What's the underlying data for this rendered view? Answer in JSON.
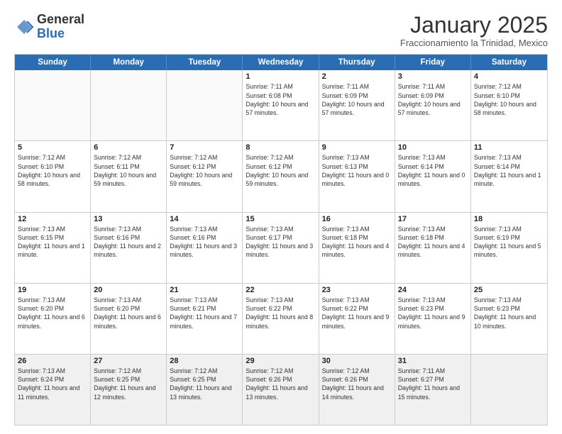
{
  "logo": {
    "general": "General",
    "blue": "Blue"
  },
  "header": {
    "month": "January 2025",
    "location": "Fraccionamiento la Trinidad, Mexico"
  },
  "weekdays": [
    "Sunday",
    "Monday",
    "Tuesday",
    "Wednesday",
    "Thursday",
    "Friday",
    "Saturday"
  ],
  "weeks": [
    [
      {
        "day": "",
        "info": "",
        "empty": true
      },
      {
        "day": "",
        "info": "",
        "empty": true
      },
      {
        "day": "",
        "info": "",
        "empty": true
      },
      {
        "day": "1",
        "info": "Sunrise: 7:11 AM\nSunset: 6:08 PM\nDaylight: 10 hours and 57 minutes."
      },
      {
        "day": "2",
        "info": "Sunrise: 7:11 AM\nSunset: 6:09 PM\nDaylight: 10 hours and 57 minutes."
      },
      {
        "day": "3",
        "info": "Sunrise: 7:11 AM\nSunset: 6:09 PM\nDaylight: 10 hours and 57 minutes."
      },
      {
        "day": "4",
        "info": "Sunrise: 7:12 AM\nSunset: 6:10 PM\nDaylight: 10 hours and 58 minutes."
      }
    ],
    [
      {
        "day": "5",
        "info": "Sunrise: 7:12 AM\nSunset: 6:10 PM\nDaylight: 10 hours and 58 minutes."
      },
      {
        "day": "6",
        "info": "Sunrise: 7:12 AM\nSunset: 6:11 PM\nDaylight: 10 hours and 59 minutes."
      },
      {
        "day": "7",
        "info": "Sunrise: 7:12 AM\nSunset: 6:12 PM\nDaylight: 10 hours and 59 minutes."
      },
      {
        "day": "8",
        "info": "Sunrise: 7:12 AM\nSunset: 6:12 PM\nDaylight: 10 hours and 59 minutes."
      },
      {
        "day": "9",
        "info": "Sunrise: 7:13 AM\nSunset: 6:13 PM\nDaylight: 11 hours and 0 minutes."
      },
      {
        "day": "10",
        "info": "Sunrise: 7:13 AM\nSunset: 6:14 PM\nDaylight: 11 hours and 0 minutes."
      },
      {
        "day": "11",
        "info": "Sunrise: 7:13 AM\nSunset: 6:14 PM\nDaylight: 11 hours and 1 minute."
      }
    ],
    [
      {
        "day": "12",
        "info": "Sunrise: 7:13 AM\nSunset: 6:15 PM\nDaylight: 11 hours and 1 minute."
      },
      {
        "day": "13",
        "info": "Sunrise: 7:13 AM\nSunset: 6:16 PM\nDaylight: 11 hours and 2 minutes."
      },
      {
        "day": "14",
        "info": "Sunrise: 7:13 AM\nSunset: 6:16 PM\nDaylight: 11 hours and 3 minutes."
      },
      {
        "day": "15",
        "info": "Sunrise: 7:13 AM\nSunset: 6:17 PM\nDaylight: 11 hours and 3 minutes."
      },
      {
        "day": "16",
        "info": "Sunrise: 7:13 AM\nSunset: 6:18 PM\nDaylight: 11 hours and 4 minutes."
      },
      {
        "day": "17",
        "info": "Sunrise: 7:13 AM\nSunset: 6:18 PM\nDaylight: 11 hours and 4 minutes."
      },
      {
        "day": "18",
        "info": "Sunrise: 7:13 AM\nSunset: 6:19 PM\nDaylight: 11 hours and 5 minutes."
      }
    ],
    [
      {
        "day": "19",
        "info": "Sunrise: 7:13 AM\nSunset: 6:20 PM\nDaylight: 11 hours and 6 minutes."
      },
      {
        "day": "20",
        "info": "Sunrise: 7:13 AM\nSunset: 6:20 PM\nDaylight: 11 hours and 6 minutes."
      },
      {
        "day": "21",
        "info": "Sunrise: 7:13 AM\nSunset: 6:21 PM\nDaylight: 11 hours and 7 minutes."
      },
      {
        "day": "22",
        "info": "Sunrise: 7:13 AM\nSunset: 6:22 PM\nDaylight: 11 hours and 8 minutes."
      },
      {
        "day": "23",
        "info": "Sunrise: 7:13 AM\nSunset: 6:22 PM\nDaylight: 11 hours and 9 minutes."
      },
      {
        "day": "24",
        "info": "Sunrise: 7:13 AM\nSunset: 6:23 PM\nDaylight: 11 hours and 9 minutes."
      },
      {
        "day": "25",
        "info": "Sunrise: 7:13 AM\nSunset: 6:23 PM\nDaylight: 11 hours and 10 minutes."
      }
    ],
    [
      {
        "day": "26",
        "info": "Sunrise: 7:13 AM\nSunset: 6:24 PM\nDaylight: 11 hours and 11 minutes."
      },
      {
        "day": "27",
        "info": "Sunrise: 7:12 AM\nSunset: 6:25 PM\nDaylight: 11 hours and 12 minutes."
      },
      {
        "day": "28",
        "info": "Sunrise: 7:12 AM\nSunset: 6:25 PM\nDaylight: 11 hours and 13 minutes."
      },
      {
        "day": "29",
        "info": "Sunrise: 7:12 AM\nSunset: 6:26 PM\nDaylight: 11 hours and 13 minutes."
      },
      {
        "day": "30",
        "info": "Sunrise: 7:12 AM\nSunset: 6:26 PM\nDaylight: 11 hours and 14 minutes."
      },
      {
        "day": "31",
        "info": "Sunrise: 7:11 AM\nSunset: 6:27 PM\nDaylight: 11 hours and 15 minutes."
      },
      {
        "day": "",
        "info": "",
        "empty": true
      }
    ]
  ]
}
